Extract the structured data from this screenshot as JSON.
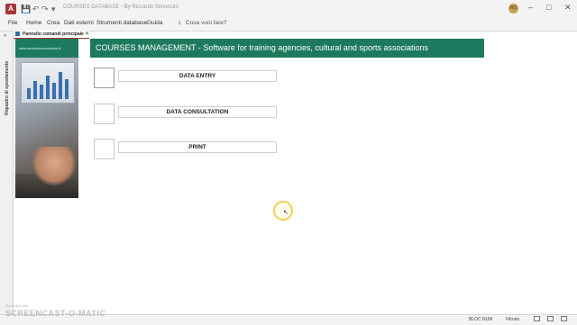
{
  "window": {
    "title": "COURSES DATABASE - By Riccardo Simoncini",
    "account_initials": "RS",
    "controls": [
      "–",
      "□",
      "✕"
    ]
  },
  "quick_access": {
    "save": "💾",
    "undo": "↶",
    "redo": "↷",
    "more": "▾"
  },
  "menu": {
    "items": [
      "File",
      "Home",
      "Crea",
      "Dati esterni",
      "Strumenti database",
      "Guida"
    ],
    "search_placeholder": "Cosa vuoi fare?"
  },
  "nav_pane": {
    "label": "Riquadro di spostamento",
    "toggle": "»"
  },
  "document_tab": {
    "label": "Pannello comandi principale",
    "close": "✕"
  },
  "form": {
    "photo_url": "www.servizioconsulenze.it",
    "banner": "COURSES MANAGEMENT - Software for training agencies, cultural and sports associations",
    "buttons": [
      {
        "label": "DATA ENTRY"
      },
      {
        "label": "DATA CONSULTATION"
      },
      {
        "label": "PRINT"
      }
    ]
  },
  "status_bar": {
    "bloc_num": "BLOC NUM",
    "filter": "Filtrato"
  },
  "watermark": {
    "main": "SCREENCAST-O-MATIC",
    "small": "Recorded with"
  },
  "colors": {
    "brand_green": "#1e7a5e",
    "access_red": "#a4373a"
  }
}
